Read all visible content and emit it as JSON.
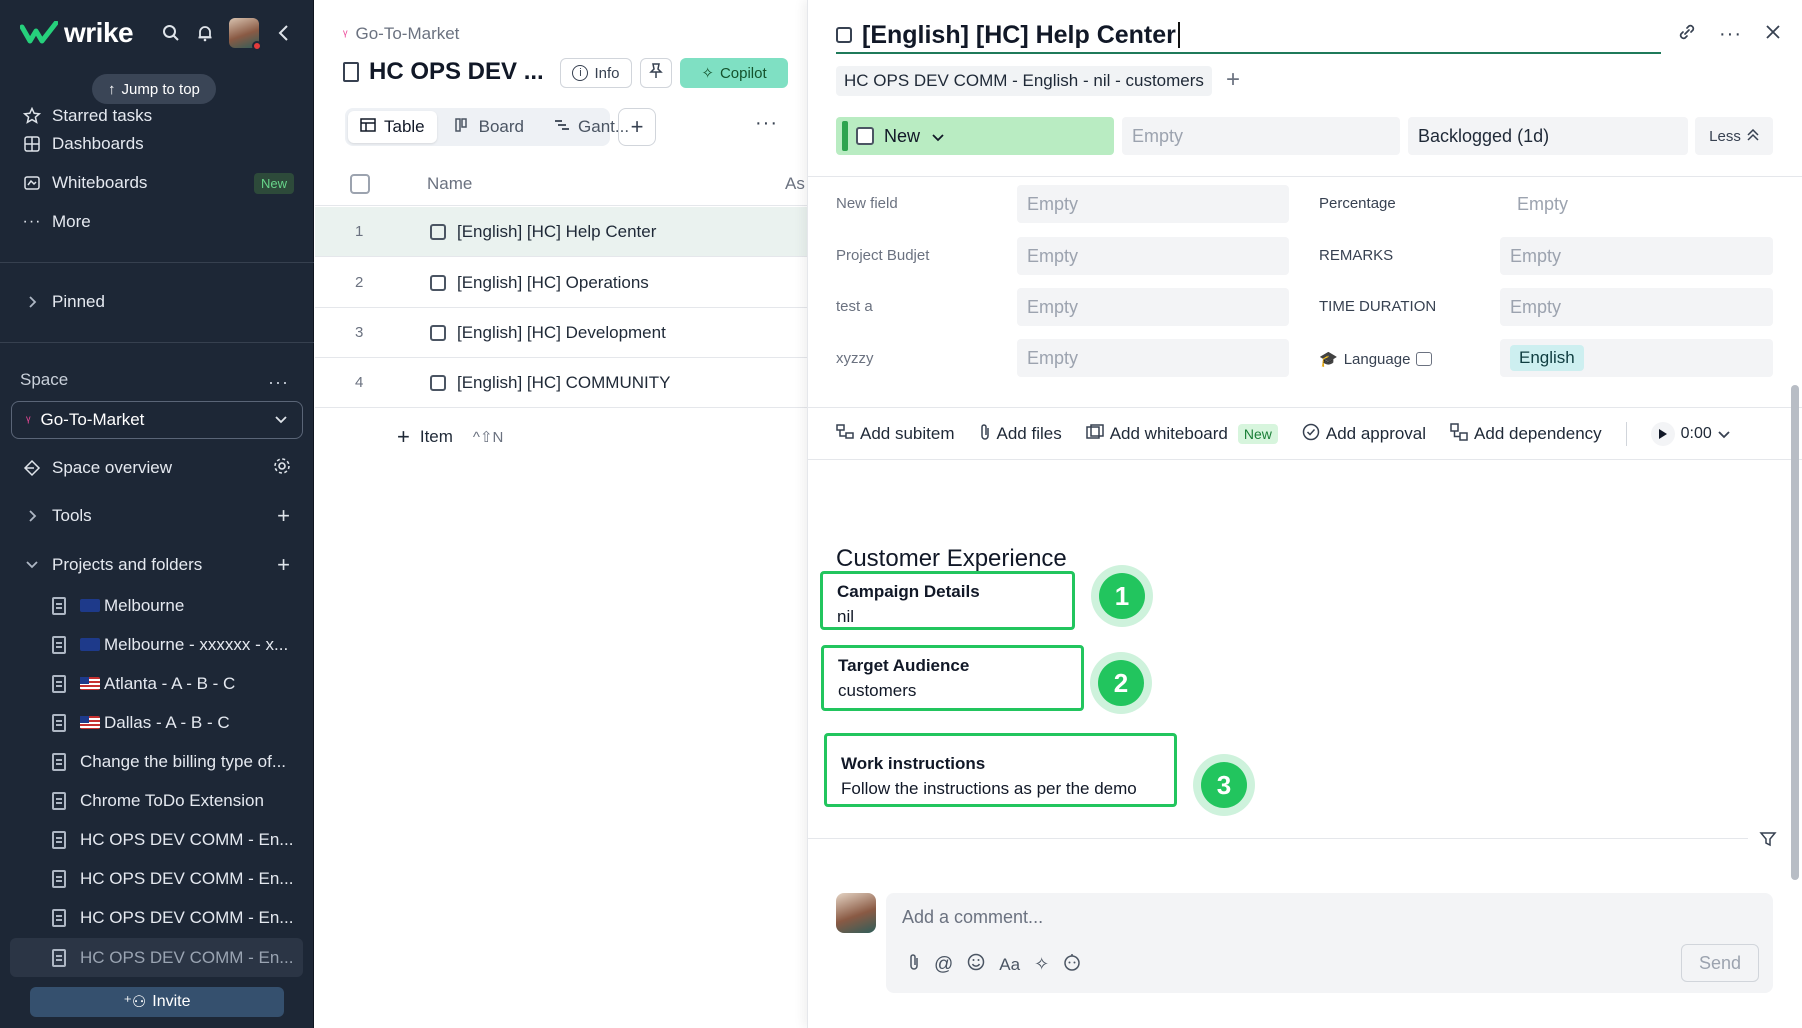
{
  "app": {
    "logo_text": "wrike",
    "jump_to_top": "Jump to top"
  },
  "sidebar": {
    "nav": [
      {
        "label": "Starred tasks",
        "icon": "star-icon"
      },
      {
        "label": "Dashboards",
        "icon": "dashboard-icon"
      },
      {
        "label": "Whiteboards",
        "icon": "whiteboard-icon",
        "badge": "New"
      },
      {
        "label": "More",
        "icon": "more-icon"
      }
    ],
    "pinned": "Pinned",
    "space_label": "Space",
    "space_selected": "Go-To-Market",
    "space_overview": "Space overview",
    "tools": "Tools",
    "projects_and_folders": "Projects and folders",
    "projects": [
      {
        "label": "Melbourne",
        "flag": "au"
      },
      {
        "label": "Melbourne - xxxxxx - x...",
        "flag": "au"
      },
      {
        "label": "Atlanta - A - B - C",
        "flag": "us"
      },
      {
        "label": "Dallas - A - B - C",
        "flag": "us"
      },
      {
        "label": "Change the billing type of..."
      },
      {
        "label": "Chrome ToDo Extension"
      },
      {
        "label": "HC OPS DEV COMM - En..."
      },
      {
        "label": "HC OPS DEV COMM - En..."
      },
      {
        "label": "HC OPS DEV COMM - En..."
      },
      {
        "label": "HC OPS DEV COMM - En..."
      }
    ],
    "invite": "Invite"
  },
  "middle": {
    "breadcrumb": "Go-To-Market",
    "title": "HC OPS DEV ...",
    "info": "Info",
    "copilot": "Copilot",
    "views": [
      "Table",
      "Board",
      "Gant..."
    ],
    "columns": {
      "name": "Name",
      "assignee": "As"
    },
    "rows": [
      {
        "num": "1",
        "name": "[English] [HC] Help Center"
      },
      {
        "num": "2",
        "name": "[English] [HC] Operations"
      },
      {
        "num": "3",
        "name": "[English] [HC] Development"
      },
      {
        "num": "4",
        "name": "[English] [HC] COMMUNITY"
      }
    ],
    "add_item": "Item",
    "add_item_shortcut": "^⇧N"
  },
  "detail": {
    "title": "[English] [HC] Help Center",
    "parent_chip": "HC OPS DEV COMM - English - nil - customers",
    "status": "New",
    "assignee": "Empty",
    "schedule": "Backlogged (1d)",
    "less": "Less",
    "fields_left": [
      {
        "label": "New field",
        "value": "Empty"
      },
      {
        "label": "Project Budjet",
        "value": "Empty"
      },
      {
        "label": "test a",
        "value": "Empty"
      },
      {
        "label": "xyzzy",
        "value": "Empty"
      }
    ],
    "fields_right": [
      {
        "label": "Percentage",
        "value": "Empty"
      },
      {
        "label": "REMARKS",
        "value": "Empty"
      },
      {
        "label": "TIME DURATION",
        "value": "Empty"
      },
      {
        "label": "Language",
        "value": "English"
      }
    ],
    "toolbar": {
      "add_subitem": "Add subitem",
      "add_files": "Add files",
      "add_whiteboard": "Add whiteboard",
      "new_badge": "New",
      "add_approval": "Add approval",
      "add_dependency": "Add dependency",
      "timer": "0:00"
    },
    "section_title": "Customer Experience",
    "highlights": [
      {
        "label": "Campaign Details",
        "value": "nil",
        "badge": "1"
      },
      {
        "label": "Target Audience",
        "value": "customers",
        "badge": "2"
      },
      {
        "label": "Work instructions",
        "value": "Follow the instructions as per the demo",
        "badge": "3"
      }
    ],
    "comment_placeholder": "Add a comment...",
    "comment_tool_text": "Aa",
    "send": "Send"
  },
  "colors": {
    "sidebar_bg": "#1d2736",
    "accent_green": "#22c55e",
    "status_green": "#b9ecc2",
    "copilot": "#7fe0c3"
  }
}
